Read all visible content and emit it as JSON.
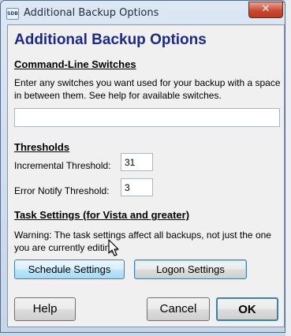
{
  "window": {
    "title": "Additional Backup Options",
    "app_icon_text": "SDB",
    "close_glyph": "✕"
  },
  "dialog": {
    "heading": "Additional Backup Options",
    "command_line": {
      "section_title": "Command-Line Switches",
      "description": "Enter any switches you want used for your backup with a space in between them. See help for available switches.",
      "switches_value": ""
    },
    "thresholds": {
      "section_title": "Thresholds",
      "incremental_label": "Incremental Threshold:",
      "incremental_value": "31",
      "error_notify_label": "Error Notify Threshold:",
      "error_notify_value": "3"
    },
    "task_settings": {
      "section_title": "Task Settings (for Vista and greater)",
      "warning": "Warning: The task settings affect all backups, not just the one you are currently editing.",
      "schedule_button": "Schedule Settings",
      "logon_button": "Logon Settings"
    },
    "buttons": {
      "help": "Help",
      "cancel": "Cancel",
      "ok": "OK"
    }
  },
  "colors": {
    "heading": "#1c2a86",
    "close_button": "#c84a32",
    "dialog_background": "#f0f0f0",
    "hover_button": "#bee6fd"
  },
  "icons": {
    "app": "sdb-app-icon",
    "close": "close-icon",
    "cursor": "mouse-pointer-icon"
  }
}
